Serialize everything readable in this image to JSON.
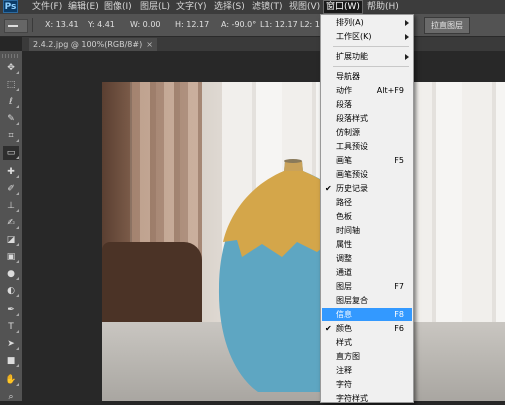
{
  "menubar": {
    "logo": "Ps",
    "items": [
      "文件(F)",
      "编辑(E)",
      "图像(I)",
      "图层(L)",
      "文字(Y)",
      "选择(S)",
      "滤镜(T)",
      "视图(V)",
      "窗口(W)",
      "帮助(H)"
    ],
    "active_index": 8
  },
  "options": {
    "x": "X: 13.41",
    "y": "Y: 4.41",
    "w": "W: 0.00",
    "h": "H: 12.17",
    "a": "A: -90.0°",
    "l1": "L1: 12.17",
    "l2": "L2: 12.17",
    "straighten_button": "拉直图层"
  },
  "document": {
    "tab_title": "2.4.2.jpg @ 100%(RGB/8#)",
    "close": "×"
  },
  "tools": [
    "move-tool",
    "marquee-tool",
    "lasso-tool",
    "quick-select-tool",
    "crop-tool",
    "ruler-tool",
    "healing-tool",
    "brush-tool",
    "clone-stamp-tool",
    "history-brush-tool",
    "eraser-tool",
    "gradient-tool",
    "blur-tool",
    "dodge-tool",
    "pen-tool",
    "type-tool",
    "path-select-tool",
    "shape-tool",
    "hand-tool",
    "zoom-tool"
  ],
  "window_menu": {
    "items": [
      {
        "label": "排列(A)",
        "submenu": true
      },
      {
        "label": "工作区(K)",
        "submenu": true
      },
      {
        "separator": true
      },
      {
        "label": "扩展功能",
        "submenu": true
      },
      {
        "separator": true
      },
      {
        "label": "导航器"
      },
      {
        "label": "动作",
        "shortcut": "Alt+F9"
      },
      {
        "label": "段落"
      },
      {
        "label": "段落样式"
      },
      {
        "label": "仿制源"
      },
      {
        "label": "工具预设"
      },
      {
        "label": "画笔",
        "shortcut": "F5"
      },
      {
        "label": "画笔预设"
      },
      {
        "label": "历史记录",
        "checked": true
      },
      {
        "label": "路径"
      },
      {
        "label": "色板"
      },
      {
        "label": "时间轴"
      },
      {
        "label": "属性"
      },
      {
        "label": "调整"
      },
      {
        "label": "通道"
      },
      {
        "label": "图层",
        "shortcut": "F7"
      },
      {
        "label": "图层复合"
      },
      {
        "label": "信息",
        "shortcut": "F8",
        "highlighted": true
      },
      {
        "label": "颜色",
        "shortcut": "F6",
        "checked": true
      },
      {
        "label": "样式"
      },
      {
        "label": "直方图"
      },
      {
        "label": "注释"
      },
      {
        "label": "字符"
      },
      {
        "label": "字符样式"
      }
    ]
  },
  "colors": {
    "highlight": "#3399ff",
    "vase_blue": "#5ea6c2",
    "vase_gold": "#d4a64a"
  }
}
